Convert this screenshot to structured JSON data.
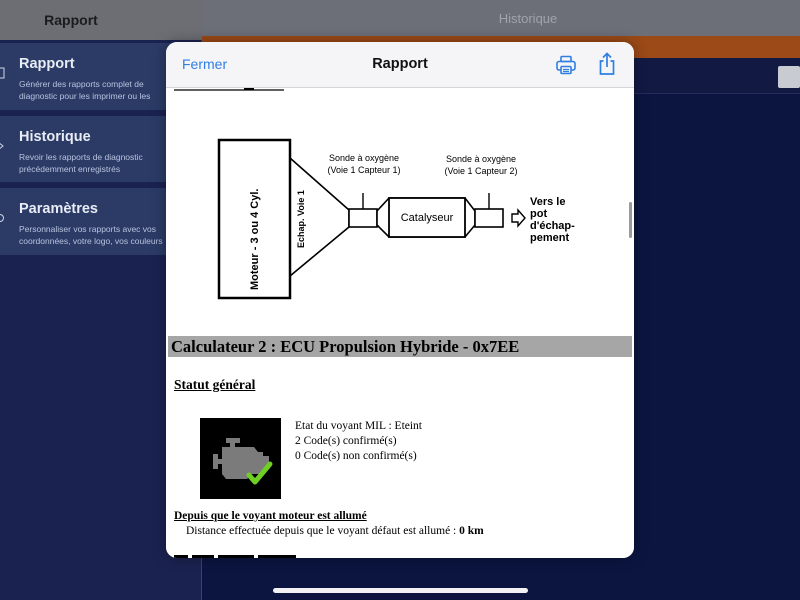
{
  "sidebar": {
    "header_title": "Rapport",
    "items": [
      {
        "title": "Rapport",
        "description": "Générer des rapports complet de\ndiagnostic pour les imprimer ou les"
      },
      {
        "title": "Historique",
        "description": "Revoir les rapports de diagnostic\nprécédemment enregistrés"
      },
      {
        "title": "Paramètres",
        "description": "Personnaliser vos rapports avec vos\ncoordonnées, votre logo, vos couleurs"
      }
    ]
  },
  "detail": {
    "header_title": "Historique"
  },
  "sheet": {
    "close_label": "Fermer",
    "title": "Rapport",
    "print_icon": "printer-icon",
    "share_icon": "share-icon"
  },
  "report": {
    "diagram": {
      "engine_label": "Moteur - 3 ou 4 Cyl.",
      "manifold_label": "Echap. Voie 1",
      "sensor1_label_line1": "Sonde à oxygène",
      "sensor1_label_line2": "(Voie 1 Capteur 1)",
      "catalyst_label": "Catalyseur",
      "sensor2_label_line1": "Sonde à oxygène",
      "sensor2_label_line2": "(Voie 1 Capteur 2)",
      "exhaust_line1": "Vers le",
      "exhaust_line2": "pot",
      "exhaust_line3": "d'échap-",
      "exhaust_line4": "pement"
    },
    "ecu_title": "Calculateur 2 : ECU Propulsion Hybride - 0x7EE",
    "status_title": "Statut général",
    "status_icon": "engine-check-icon",
    "mil_status": "Etat du voyant MIL : Eteint",
    "confirmed_codes": "2 Code(s) confirmé(s)",
    "unconfirmed_codes": "0 Code(s) non confirmé(s)",
    "since_mil_title": "Depuis que le voyant moteur est allumé",
    "distance_label": "Distance effectuée depuis que le voyant défaut est allumé : ",
    "distance_value": "0 km"
  },
  "colors": {
    "accent_blue": "#2f7fe3",
    "orange_bar": "#9c4a17",
    "app_background": "#0b1540",
    "sidebar_item_bg": "#2b3b66",
    "check_green": "#6fcf23"
  }
}
